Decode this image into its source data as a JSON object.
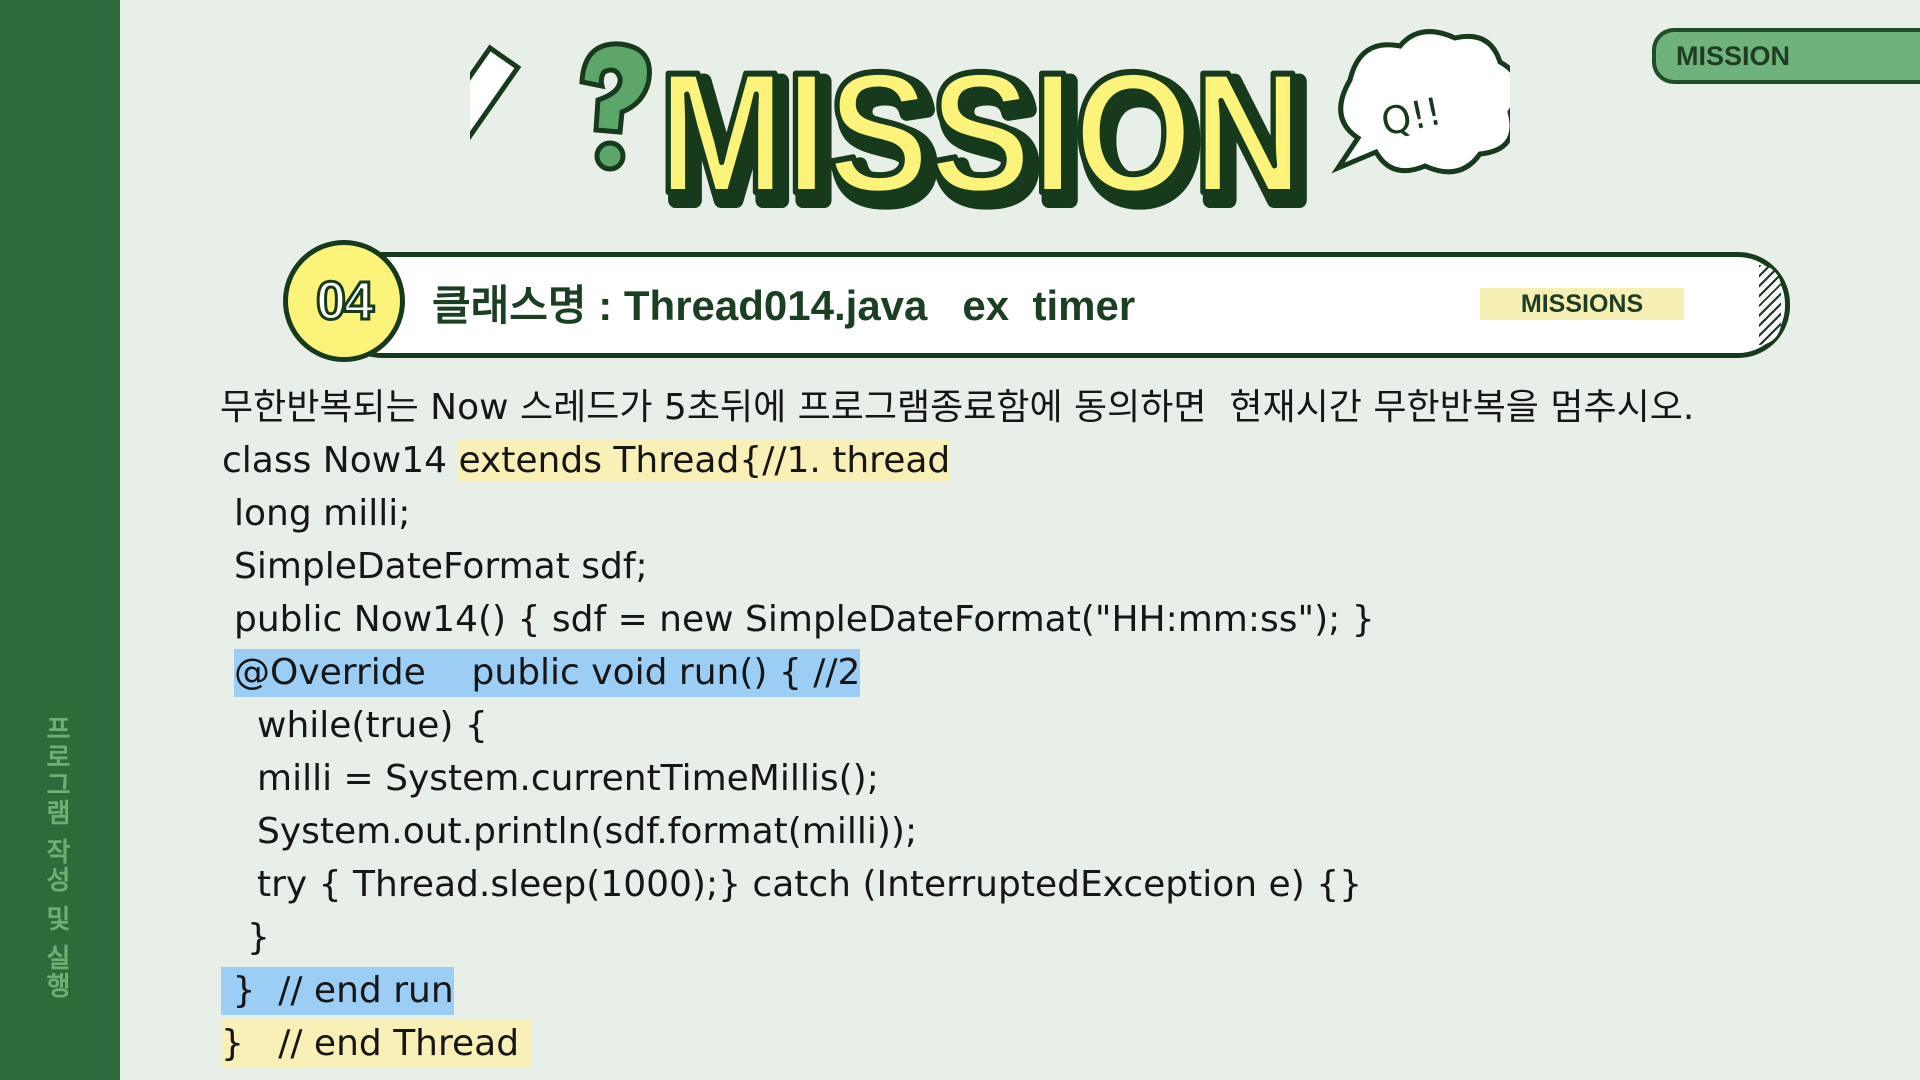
{
  "sidebar": {
    "vertical_text": "프로그램 작성 및 실행"
  },
  "corner_tab": {
    "label": "MISSION"
  },
  "title": {
    "word": "MISSION",
    "bubble_text": "Q!!"
  },
  "mission": {
    "number": "04",
    "class_line": "클래스명 : Thread014.java   ex  timer",
    "tag": "MISSIONS"
  },
  "description": "무한반복되는 Now 스레드가 5초뒤에 프로그램종료함에 동의하면  현재시간 무한반복을 멈추시오.",
  "code": {
    "l1_a": "class Now14 ",
    "l1_b": "extends Thread{//1. thread",
    "l2": "long milli;",
    "l3": "SimpleDateFormat sdf;",
    "l4": "public Now14() { sdf = new SimpleDateFormat(\"HH:mm:ss\"); }",
    "l5": "@Override    public void run() { //2",
    "l6": "while(true) {",
    "l7": "milli = System.currentTimeMillis();",
    "l8": "System.out.println(sdf.format(milli));",
    "l9": "try { Thread.sleep(1000);} catch (InterruptedException e) {}",
    "l10": "}",
    "l11": " }  // end run",
    "l12": "}   // end Thread "
  },
  "colors": {
    "background": "#e8efe8",
    "sidebar": "#2f6b3a",
    "title_yellow": "#fbf37a",
    "highlight_yellow": "#f8f0b6",
    "highlight_blue": "#9ccdf5"
  }
}
